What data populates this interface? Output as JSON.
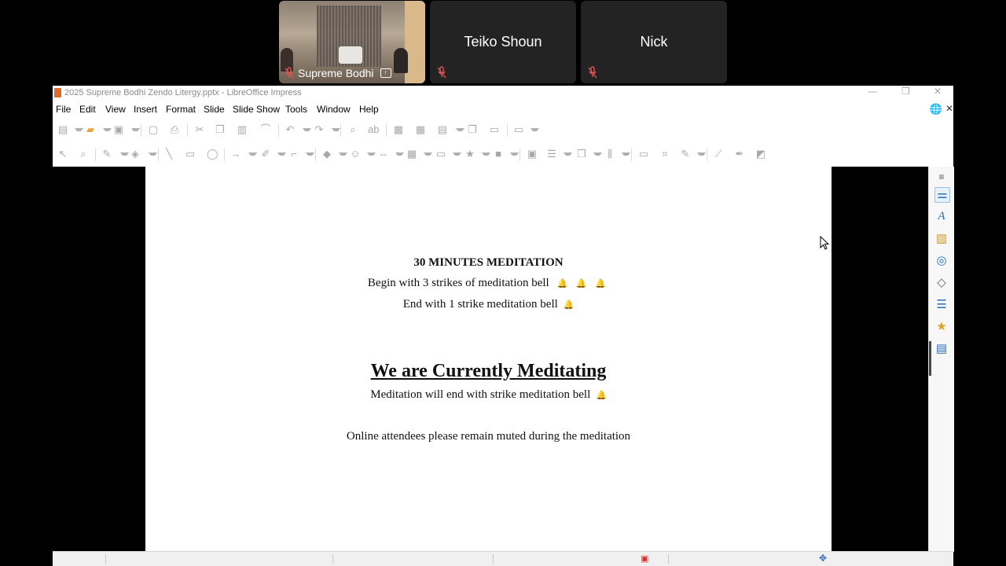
{
  "participants": [
    {
      "name": "Supreme Bodhi",
      "has_video": true,
      "muted": true,
      "sharing": true
    },
    {
      "name": "Teiko Shoun",
      "has_video": false,
      "muted": true
    },
    {
      "name": "Nick",
      "has_video": false,
      "muted": true
    }
  ],
  "window": {
    "title": "2025 Supreme Bodhi Zendo Litergy.pptx - LibreOffice Impress"
  },
  "menu": [
    "File",
    "Edit",
    "View",
    "Insert",
    "Format",
    "Slide",
    "Slide Show",
    "Tools",
    "Window",
    "Help"
  ],
  "slide": {
    "heading": "30 MINUTES MEDITATION",
    "line_begin": "Begin with 3 strikes of meditation bell",
    "bell_symbols_begin": "🔔  🔔  🔔",
    "line_end": "End with 1 strike meditation bell",
    "bell_symbol_end": "🔔",
    "big_heading": "We are Currently Meditating",
    "line_meditation_end": "Meditation will end with strike meditation bell",
    "bell_symbol_med_end": "🔔",
    "line_online": "Online attendees please remain muted during the meditation"
  },
  "colors": {
    "mic_muted": "#e05252",
    "tile_bg": "#232323",
    "sidebar_accent": "#2a6ebb",
    "doc_icon": "#e06a2a"
  },
  "sidebar_icons": [
    "menu-icon",
    "properties-icon",
    "styles-icon",
    "gallery-icon",
    "navigator-icon",
    "shapes-icon",
    "slide-transition-icon",
    "animation-icon",
    "master-slides-icon"
  ]
}
